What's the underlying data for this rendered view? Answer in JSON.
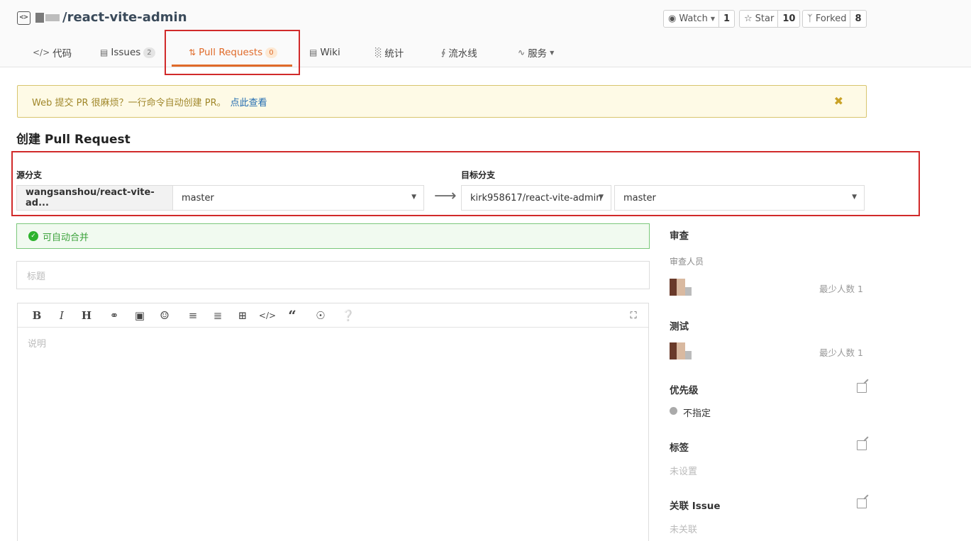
{
  "header": {
    "repo_name": "/react-vite-admin",
    "watch": {
      "label": "Watch",
      "count": "1"
    },
    "star": {
      "label": "Star",
      "count": "10"
    },
    "forked": {
      "label": "Forked",
      "count": "8"
    }
  },
  "tabs": [
    {
      "label": "代码",
      "icon": "code-icon"
    },
    {
      "label": "Issues",
      "icon": "issues-icon",
      "badge": "2"
    },
    {
      "label": "Pull Requests",
      "icon": "pull-request-icon",
      "badge": "0"
    },
    {
      "label": "Wiki",
      "icon": "book-icon"
    },
    {
      "label": "统计",
      "icon": "bar-chart-icon"
    },
    {
      "label": "流水线",
      "icon": "pipeline-icon"
    },
    {
      "label": "服务",
      "icon": "pulse-icon"
    }
  ],
  "banner": {
    "text": "Web 提交 PR 很麻烦？一行命令自动创建 PR。",
    "link": "点此查看"
  },
  "page_title": "创建 Pull Request",
  "source": {
    "label": "源分支",
    "repo": "wangsanshou/react-vite-ad...",
    "branch": "master"
  },
  "target": {
    "label": "目标分支",
    "repo": "kirk958617/react-vite-admin",
    "branch": "master"
  },
  "merge_status": "可自动合并",
  "title_placeholder": "标题",
  "description_placeholder": "说明",
  "sidebar": {
    "review": {
      "heading": "审查",
      "sub": "审查人员",
      "min": "最少人数 1"
    },
    "test": {
      "heading": "测试",
      "min": "最少人数 1"
    },
    "priority": {
      "heading": "优先级",
      "value": "不指定"
    },
    "labels": {
      "heading": "标签",
      "value": "未设置"
    },
    "issue": {
      "heading": "关联 Issue",
      "value": "未关联"
    }
  },
  "colors": {
    "accent": "#e06b2a",
    "highlight_box": "#d12a2a",
    "success": "#2db32d"
  }
}
